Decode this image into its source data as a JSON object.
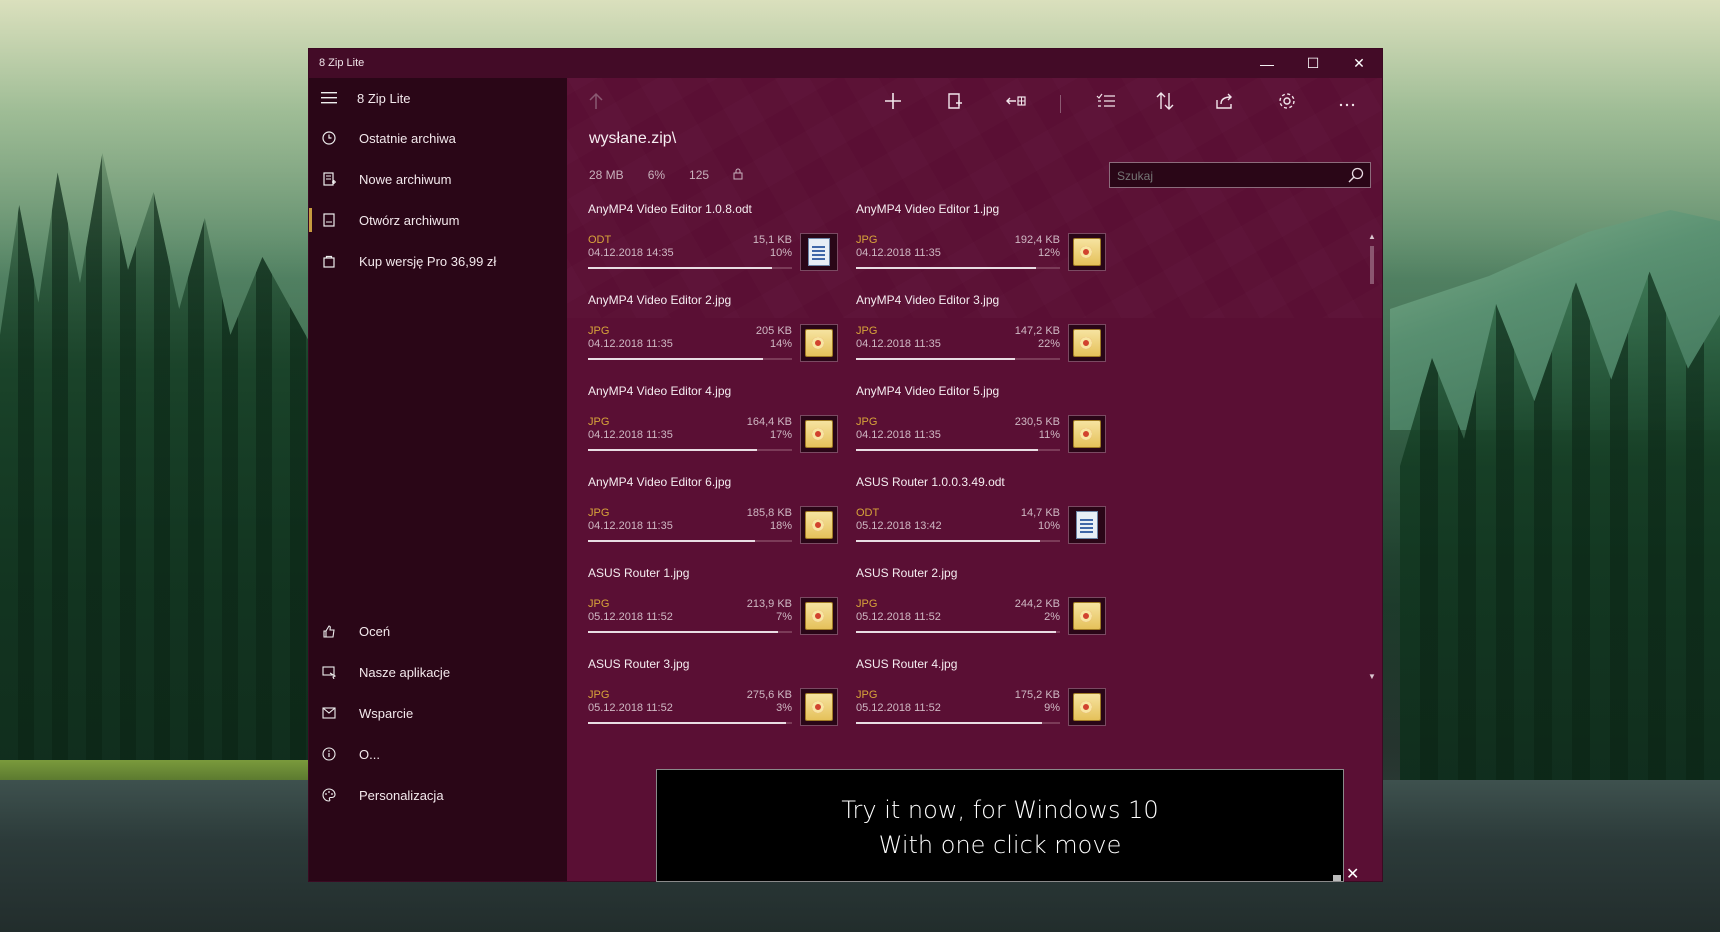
{
  "window": {
    "title": "8 Zip Lite",
    "controls": {
      "minimize": "—",
      "maximize": "☐",
      "close": "✕"
    }
  },
  "sidebar": {
    "app_name": "8 Zip Lite",
    "items": [
      {
        "label": "Ostatnie archiwa",
        "icon": "clock-icon"
      },
      {
        "label": "Nowe archiwum",
        "icon": "new-archive-icon"
      },
      {
        "label": "Otwórz archiwum",
        "icon": "open-archive-icon",
        "active": true
      },
      {
        "label": "Kup wersję Pro  36,99 zł",
        "icon": "shopping-bag-icon"
      }
    ],
    "bottom_items": [
      {
        "label": "Oceń",
        "icon": "thumbs-up-icon"
      },
      {
        "label": "Nasze aplikacje",
        "icon": "apps-icon"
      },
      {
        "label": "Wsparcie",
        "icon": "mail-icon"
      },
      {
        "label": "O...",
        "icon": "info-icon"
      },
      {
        "label": "Personalizacja",
        "icon": "palette-icon"
      }
    ]
  },
  "main": {
    "path": "wysłane.zip\\",
    "stats": {
      "size": "28 MB",
      "ratio": "6%",
      "count": "125"
    },
    "search": {
      "placeholder": "Szukaj"
    },
    "toolbar": [
      "up-arrow-icon",
      "add-icon",
      "extract-icon",
      "move-icon",
      "select-icon",
      "sort-icon",
      "share-icon",
      "settings-icon",
      "more-icon"
    ],
    "files": [
      {
        "name": "AnyMP4 Video Editor 1.0.8.odt",
        "type": "ODT",
        "date": "04.12.2018 14:35",
        "size": "15,1 KB",
        "ratio": "10%",
        "progress": 0.9,
        "kind": "odt"
      },
      {
        "name": "AnyMP4 Video Editor 1.jpg",
        "type": "JPG",
        "date": "04.12.2018 11:35",
        "size": "192,4 KB",
        "ratio": "12%",
        "progress": 0.88,
        "kind": "jpg"
      },
      {
        "name": "AnyMP4 Video Editor 2.jpg",
        "type": "JPG",
        "date": "04.12.2018 11:35",
        "size": "205 KB",
        "ratio": "14%",
        "progress": 0.86,
        "kind": "jpg"
      },
      {
        "name": "AnyMP4 Video Editor 3.jpg",
        "type": "JPG",
        "date": "04.12.2018 11:35",
        "size": "147,2 KB",
        "ratio": "22%",
        "progress": 0.78,
        "kind": "jpg"
      },
      {
        "name": "AnyMP4 Video Editor 4.jpg",
        "type": "JPG",
        "date": "04.12.2018 11:35",
        "size": "164,4 KB",
        "ratio": "17%",
        "progress": 0.83,
        "kind": "jpg"
      },
      {
        "name": "AnyMP4 Video Editor 5.jpg",
        "type": "JPG",
        "date": "04.12.2018 11:35",
        "size": "230,5 KB",
        "ratio": "11%",
        "progress": 0.89,
        "kind": "jpg"
      },
      {
        "name": "AnyMP4 Video Editor 6.jpg",
        "type": "JPG",
        "date": "04.12.2018 11:35",
        "size": "185,8 KB",
        "ratio": "18%",
        "progress": 0.82,
        "kind": "jpg"
      },
      {
        "name": "ASUS Router 1.0.0.3.49.odt",
        "type": "ODT",
        "date": "05.12.2018 13:42",
        "size": "14,7 KB",
        "ratio": "10%",
        "progress": 0.9,
        "kind": "odt"
      },
      {
        "name": "ASUS Router 1.jpg",
        "type": "JPG",
        "date": "05.12.2018 11:52",
        "size": "213,9 KB",
        "ratio": "7%",
        "progress": 0.93,
        "kind": "jpg"
      },
      {
        "name": "ASUS Router 2.jpg",
        "type": "JPG",
        "date": "05.12.2018 11:52",
        "size": "244,2 KB",
        "ratio": "2%",
        "progress": 0.98,
        "kind": "jpg"
      },
      {
        "name": "ASUS Router 3.jpg",
        "type": "JPG",
        "date": "05.12.2018 11:52",
        "size": "275,6 KB",
        "ratio": "3%",
        "progress": 0.97,
        "kind": "jpg"
      },
      {
        "name": "ASUS Router 4.jpg",
        "type": "JPG",
        "date": "05.12.2018 11:52",
        "size": "175,2 KB",
        "ratio": "9%",
        "progress": 0.91,
        "kind": "jpg"
      }
    ]
  },
  "promo": {
    "line1": "Try it now, for Windows 10",
    "line2": "With one click move",
    "close": "✕"
  }
}
